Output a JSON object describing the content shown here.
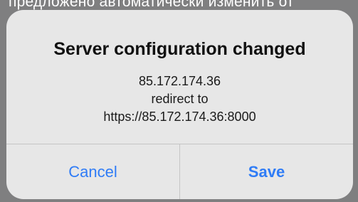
{
  "backdrop": {
    "text": "предложено автоматически изменить от"
  },
  "alert": {
    "title": "Server configuration changed",
    "message_lines": [
      "85.172.174.36",
      "redirect to",
      "https://85.172.174.36:8000"
    ],
    "buttons": {
      "cancel": "Cancel",
      "save": "Save"
    }
  },
  "colors": {
    "accent": "#2f7cf6",
    "alert_background": "#e7e7e7",
    "dim_background": "#7f7f80"
  }
}
